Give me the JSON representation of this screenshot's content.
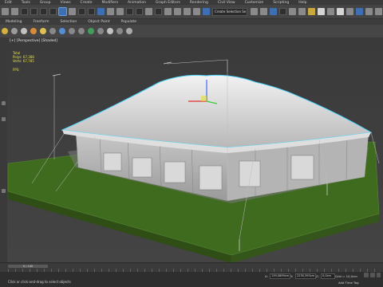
{
  "menu": [
    "Edit",
    "Tools",
    "Group",
    "Views",
    "Create",
    "Modifiers",
    "Animation",
    "Graph Editors",
    "Rendering",
    "Civil View",
    "Customize",
    "Scripting",
    "Help"
  ],
  "selection_set_placeholder": "Create Selection Se",
  "ribbon_tabs": [
    "Modeling",
    "Freeform",
    "Selection",
    "Object Paint",
    "Populate"
  ],
  "viewport": {
    "label": "[+] [Perspective] [Shaded]",
    "stats_title": "Total",
    "polys_label": "Polys:",
    "polys_value": "67,386",
    "verts_label": "Verts:",
    "verts_value": "67,785",
    "fps_label": "FPS:"
  },
  "timeline": {
    "slider_text": "0 / 100"
  },
  "status": {
    "prompt": "Click or click-and-drag to select objects",
    "x_label": "X:",
    "x_value": "139,0899cm",
    "y_label": "Y:",
    "y_value": "2230,393cm",
    "z_label": "Z:",
    "z_value": "0,0cm",
    "grid_label": "Grid = 10,0cm",
    "add_time_tag": "Add Time Tag"
  },
  "colors": {
    "accent": "#3d6fb3",
    "selection_outline": "#4fd8ff",
    "grass": "#3f6b1e",
    "yellow_stats": "#e8e050"
  }
}
